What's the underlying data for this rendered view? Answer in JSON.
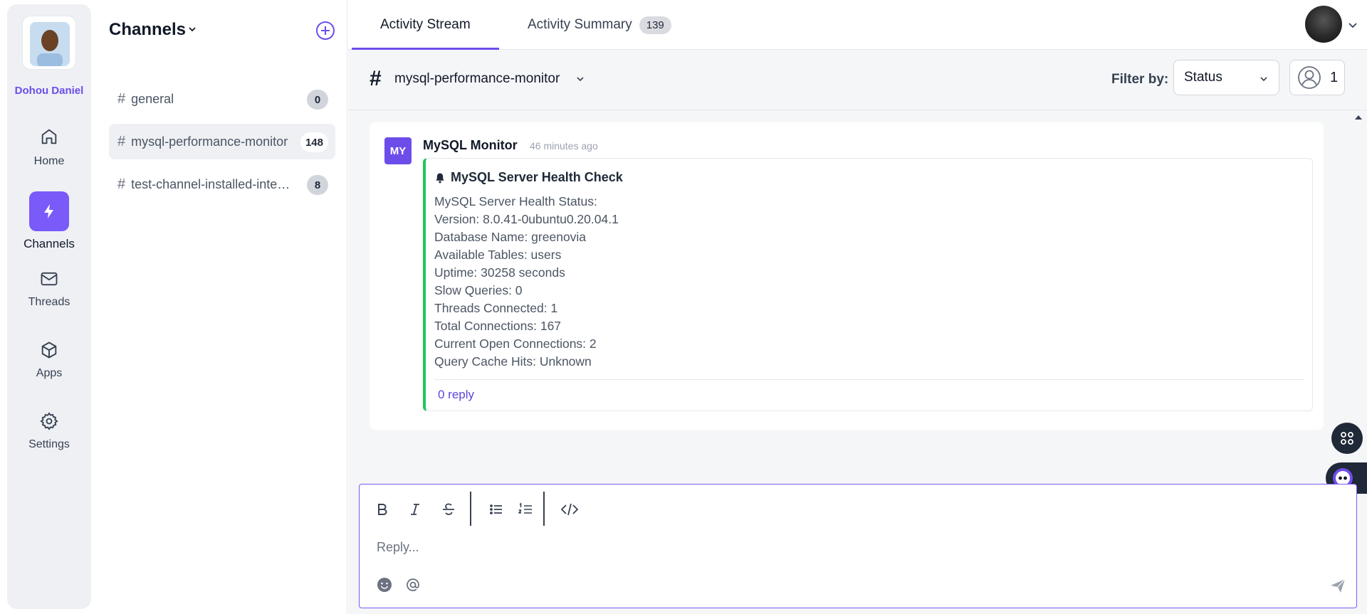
{
  "rail": {
    "user_name": "Dohou Daniel",
    "items": [
      {
        "label": "Home",
        "icon": "home-icon"
      },
      {
        "label": "Channels",
        "icon": "bolt-icon",
        "active": true
      },
      {
        "label": "Threads",
        "icon": "mail-icon"
      },
      {
        "label": "Apps",
        "icon": "cube-icon"
      },
      {
        "label": "Settings",
        "icon": "gear-icon"
      }
    ]
  },
  "channels": {
    "title": "Channels",
    "items": [
      {
        "name": "general",
        "count": "0"
      },
      {
        "name": "mysql-performance-monitor",
        "count": "148",
        "active": true
      },
      {
        "name": "test-channel-installed-integration",
        "count": "8"
      }
    ]
  },
  "tabs": [
    {
      "label": "Activity Stream",
      "active": true
    },
    {
      "label": "Activity Summary",
      "badge": "139"
    }
  ],
  "subbar": {
    "channel": "mysql-performance-monitor",
    "filter_label": "Filter by:",
    "filter_value": "Status",
    "members_count": "1"
  },
  "message": {
    "avatar_initials": "MY",
    "author": "MySQL Monitor",
    "time": "46 minutes ago",
    "title": "MySQL Server Health Check",
    "lines": [
      "MySQL Server Health Status:",
      "Version: 8.0.41-0ubuntu0.20.04.1",
      "Database Name: greenovia",
      "Available Tables: users",
      "Uptime: 30258 seconds",
      "Slow Queries: 0",
      "Threads Connected: 1",
      "Total Connections: 167",
      "Current Open Connections: 2",
      "Query Cache Hits: Unknown"
    ],
    "reply_label": "0 reply"
  },
  "composer": {
    "placeholder": "Reply..."
  },
  "colors": {
    "accent": "#6d4dea",
    "success": "#22c55e"
  }
}
